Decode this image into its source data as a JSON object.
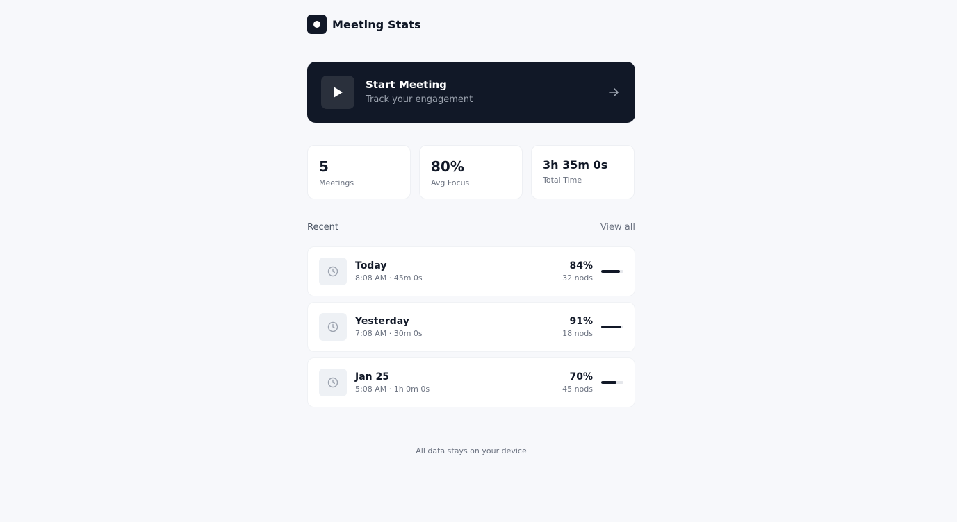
{
  "app": {
    "title": "Meeting Stats"
  },
  "start": {
    "title": "Start Meeting",
    "subtitle": "Track your engagement"
  },
  "stats": [
    {
      "value": "5",
      "label": "Meetings"
    },
    {
      "value": "80%",
      "label": "Avg Focus"
    },
    {
      "value": "3h 35m 0s",
      "label": "Total Time"
    }
  ],
  "recent": {
    "title": "Recent",
    "view_all": "View all",
    "items": [
      {
        "title": "Today",
        "subtitle": "8:08 AM · 45m 0s",
        "percent": "84%",
        "nods": "32 nods",
        "focus": 0.84
      },
      {
        "title": "Yesterday",
        "subtitle": "7:08 AM · 30m 0s",
        "percent": "91%",
        "nods": "18 nods",
        "focus": 0.91
      },
      {
        "title": "Jan 25",
        "subtitle": "5:08 AM · 1h 0m 0s",
        "percent": "70%",
        "nods": "45 nods",
        "focus": 0.7
      }
    ]
  },
  "footer": {
    "text": "All data stays on your device"
  },
  "colors": {
    "primary": "#111827",
    "background": "#f7f8fb",
    "muted": "#6b7280"
  },
  "icons": {
    "logo": "record-dot-icon",
    "play": "play-icon",
    "arrow": "arrow-right-icon",
    "clock": "clock-icon"
  }
}
